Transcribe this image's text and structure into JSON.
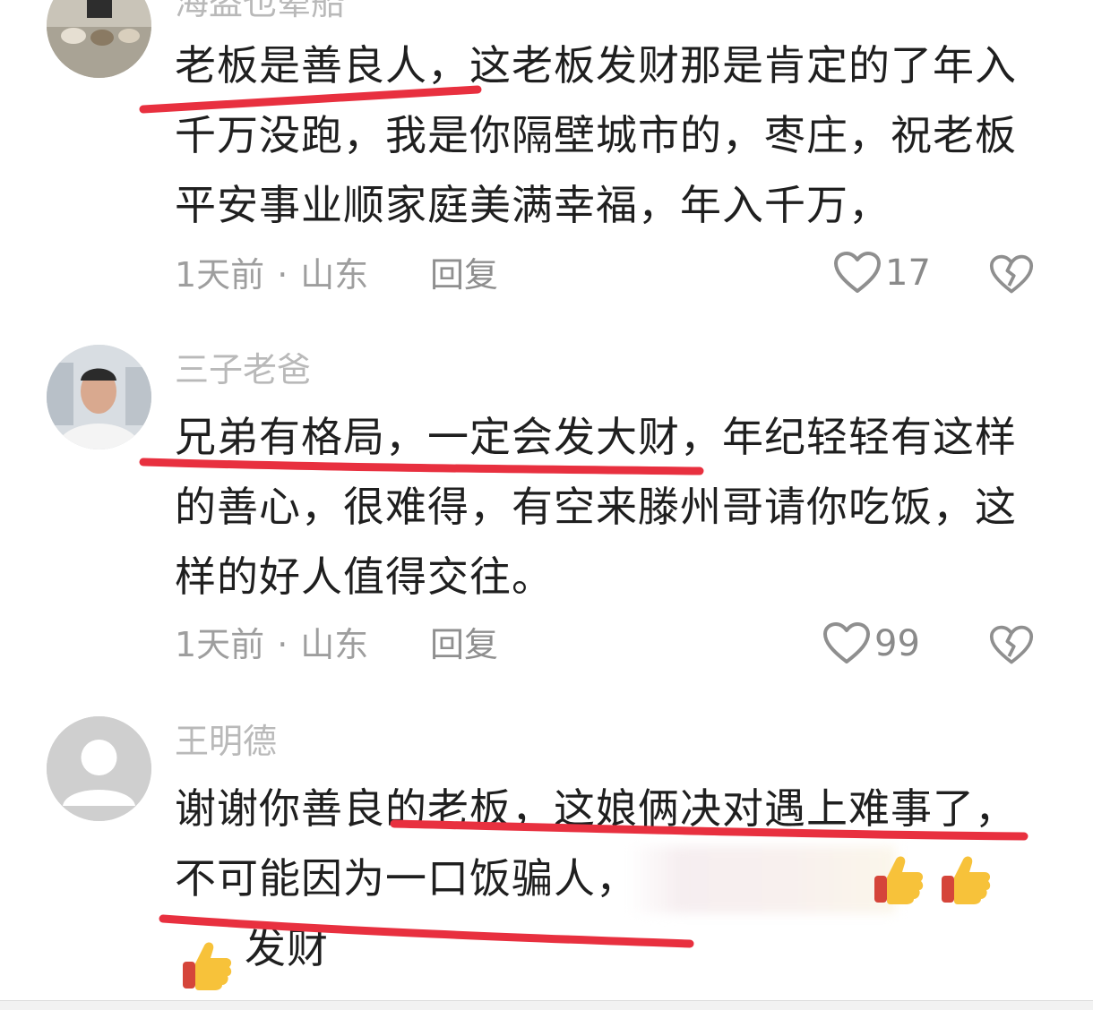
{
  "comments": [
    {
      "username": "海盗也晕船",
      "avatar_icon": "dogs-photo-avatar",
      "lines": [
        "老板是善良人，这老板发财那是肯定的了年入",
        "千万没跑，我是你隔壁城市的，枣庄，祝老板",
        "平安事业顺家庭美满幸福，年入千万，"
      ],
      "time": "1天前",
      "location": "山东",
      "reply_label": "回复",
      "likes": "17"
    },
    {
      "username": "三子老爸",
      "avatar_icon": "man-photo-avatar",
      "lines": [
        "兄弟有格局，一定会发大财，年纪轻轻有这样",
        "的善心，很难得，有空来滕州哥请你吃饭，这",
        "样的好人值得交往。"
      ],
      "time": "1天前",
      "location": "山东",
      "reply_label": "回复",
      "likes": "99"
    },
    {
      "username": "王明德",
      "avatar_icon": "default-user-avatar",
      "lines": [
        "谢谢你善良的老板，这娘俩决对遇上难事了，",
        "不可能因为一口饭骗人，",
        "发财"
      ],
      "emojis": [
        "thumbs-up-icon",
        "thumbs-up-icon",
        "thumbs-up-icon"
      ]
    }
  ],
  "colors": {
    "underline": "#e8303f",
    "meta_text": "#9e9e9e",
    "body_text": "#1f1f1f"
  }
}
